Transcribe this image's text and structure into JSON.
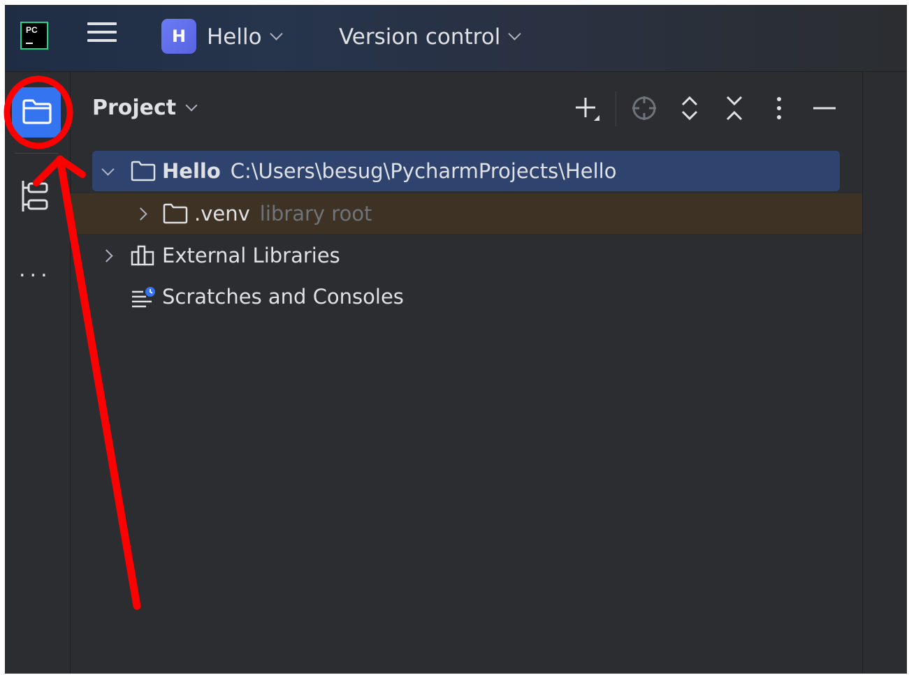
{
  "titlebar": {
    "app_icon_text": "PC",
    "project_badge": "H",
    "project_name": "Hello",
    "vcs_label": "Version control"
  },
  "tool_stripe": {
    "items": [
      {
        "name": "project",
        "icon": "folder-icon",
        "active": true
      },
      {
        "name": "structure",
        "icon": "structure-icon",
        "active": false
      },
      {
        "name": "more",
        "icon": "more-icon",
        "label": "..."
      }
    ]
  },
  "panel": {
    "title": "Project",
    "toolbar": [
      "add-icon",
      "locate-icon",
      "expand-all-icon",
      "collapse-all-icon",
      "options-icon",
      "hide-icon"
    ]
  },
  "tree": {
    "root": {
      "name": "Hello",
      "path": "C:\\Users\\besug\\PycharmProjects\\Hello",
      "expanded": true,
      "selected": true
    },
    "venv": {
      "name": ".venv",
      "hint": "library root"
    },
    "external": {
      "name": "External Libraries"
    },
    "scratches": {
      "name": "Scratches and Consoles"
    }
  },
  "colors": {
    "background": "#2b2d30",
    "accent": "#3574f0",
    "selection": "#2e436e",
    "excluded_row": "#3d3223",
    "annotation": "#ff0000"
  }
}
